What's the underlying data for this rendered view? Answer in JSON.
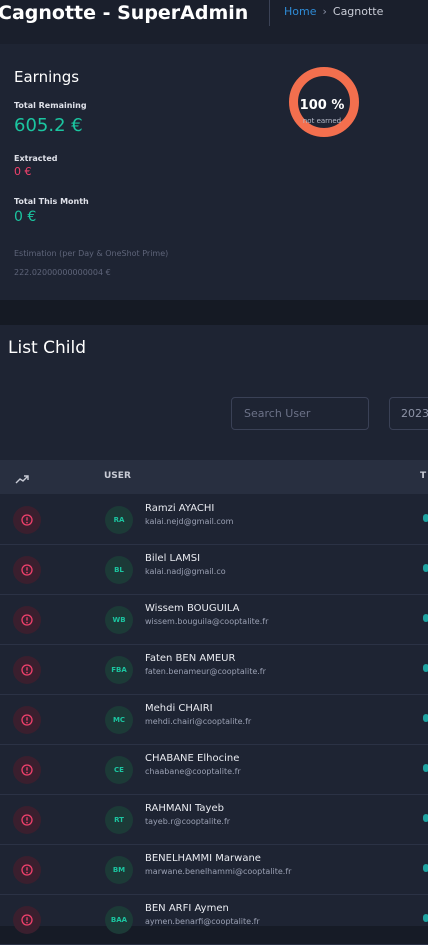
{
  "header": {
    "title": "Cagnotte - SuperAdmin",
    "breadcrumb_home": "Home",
    "breadcrumb_arrow": "›",
    "breadcrumb_current": "Cagnotte"
  },
  "earnings": {
    "title": "Earnings",
    "total_remaining_label": "Total Remaining",
    "total_remaining_value": "605.2 €",
    "extracted_label": "Extracted",
    "extracted_value": "0 €",
    "month_label": "Total This Month",
    "month_value": "0 €",
    "estimation_text": "Estimation (per Day & OneShot Prime) 222.02000000000004 €",
    "gauge_percent": "100 %",
    "gauge_caption": "not earned",
    "gauge_fraction": 1.0
  },
  "list": {
    "title": "List Child",
    "search_placeholder": "Search User",
    "year_value": "2023",
    "col_user": "USER",
    "col_t": "T",
    "trend_icon": "trend-up-icon",
    "warn_icon": "info-circle-icon",
    "rows": [
      {
        "initials": "RA",
        "name": "Ramzi AYACHI",
        "email": "kalai.nejd@gmail.com"
      },
      {
        "initials": "BL",
        "name": "Bilel LAMSI",
        "email": "kalai.nadj@gmail.co"
      },
      {
        "initials": "WB",
        "name": "Wissem BOUGUILA",
        "email": "wissem.bouguila@cooptalite.fr"
      },
      {
        "initials": "FBA",
        "name": "Faten BEN AMEUR",
        "email": "faten.benameur@cooptalite.fr"
      },
      {
        "initials": "MC",
        "name": "Mehdi CHAIRI",
        "email": "mehdi.chairi@cooptalite.fr"
      },
      {
        "initials": "CE",
        "name": "CHABANE Elhocine",
        "email": "chaabane@cooptalite.fr"
      },
      {
        "initials": "RT",
        "name": "RAHMANI Tayeb",
        "email": "tayeb.r@cooptalite.fr"
      },
      {
        "initials": "BM",
        "name": "BENELHAMMI Marwane",
        "email": "marwane.benelhammi@cooptalite.fr"
      },
      {
        "initials": "BAA",
        "name": "BEN ARFI Aymen",
        "email": "aymen.benarfi@cooptalite.fr"
      }
    ]
  },
  "colors": {
    "accent_green": "#1bc5a0",
    "danger": "#f1416c",
    "gauge": "#f36f4e",
    "link": "#2e8bd6"
  }
}
